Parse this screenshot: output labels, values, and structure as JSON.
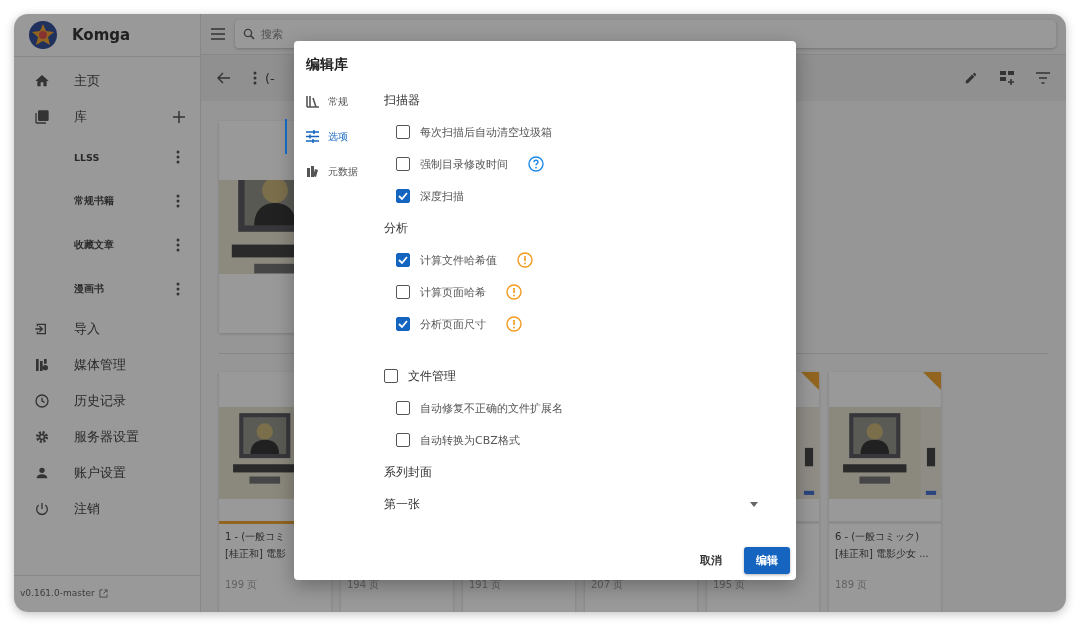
{
  "sidebar": {
    "app_name": "Komga",
    "items": [
      {
        "label": "主页",
        "kind": "nav"
      },
      {
        "label": "库",
        "kind": "section"
      },
      {
        "label": "LLSS",
        "kind": "library"
      },
      {
        "label": "常规书籍",
        "kind": "library"
      },
      {
        "label": "收藏文章",
        "kind": "library"
      },
      {
        "label": "漫画书",
        "kind": "library"
      },
      {
        "label": "导入",
        "kind": "nav"
      },
      {
        "label": "媒体管理",
        "kind": "nav"
      },
      {
        "label": "历史记录",
        "kind": "nav"
      },
      {
        "label": "服务器设置",
        "kind": "nav"
      },
      {
        "label": "账户设置",
        "kind": "nav"
      },
      {
        "label": "注销",
        "kind": "nav"
      }
    ],
    "version": "v0.161.0-master"
  },
  "search": {
    "placeholder": "搜索"
  },
  "header": {
    "title": "(-"
  },
  "books": [
    {
      "title": [
        "1 - (一般コミ",
        "[桂正和] 電影"
      ],
      "pages": "199 页",
      "level": 0.7
    },
    {
      "pages": "194 页"
    },
    {
      "pages": "191 页"
    },
    {
      "pages": "207 页"
    },
    {
      "pages": "195 页",
      "unread": true
    },
    {
      "title": [
        "6 - (一般コミック)",
        "[桂正和] 電影少女 ..."
      ],
      "pages": "189 页",
      "unread": true
    }
  ],
  "dialog": {
    "title": "编辑库",
    "tabs": [
      {
        "label": "常规",
        "selected": false
      },
      {
        "label": "选项",
        "selected": true
      },
      {
        "label": "元数据",
        "selected": false
      }
    ],
    "items": [
      {
        "kind": "heading",
        "label": "扫描器"
      },
      {
        "kind": "checkbox",
        "label": "每次扫描后自动清空垃圾箱",
        "checked": false
      },
      {
        "kind": "checkbox",
        "label": "强制目录修改时间",
        "checked": false,
        "help": true
      },
      {
        "kind": "checkbox",
        "label": "深度扫描",
        "checked": true
      },
      {
        "kind": "heading",
        "label": "分析"
      },
      {
        "kind": "checkbox",
        "label": "计算文件哈希值",
        "checked": true,
        "warning": true
      },
      {
        "kind": "checkbox",
        "label": "计算页面哈希",
        "checked": false,
        "warning": true
      },
      {
        "kind": "checkbox",
        "label": "分析页面尺寸",
        "checked": true,
        "warning": true
      },
      {
        "kind": "group",
        "label": "文件管理",
        "checked": false,
        "children": [
          {
            "kind": "checkbox",
            "label": "自动修复不正确的文件扩展名",
            "checked": false
          },
          {
            "kind": "checkbox",
            "label": "自动转换为CBZ格式",
            "checked": false
          }
        ]
      },
      {
        "kind": "heading",
        "label": "系列封面"
      },
      {
        "kind": "select",
        "value": "第一张"
      }
    ],
    "buttons": [
      {
        "label": "取消",
        "kind": "text"
      },
      {
        "label": "编辑",
        "kind": "primary"
      }
    ]
  }
}
